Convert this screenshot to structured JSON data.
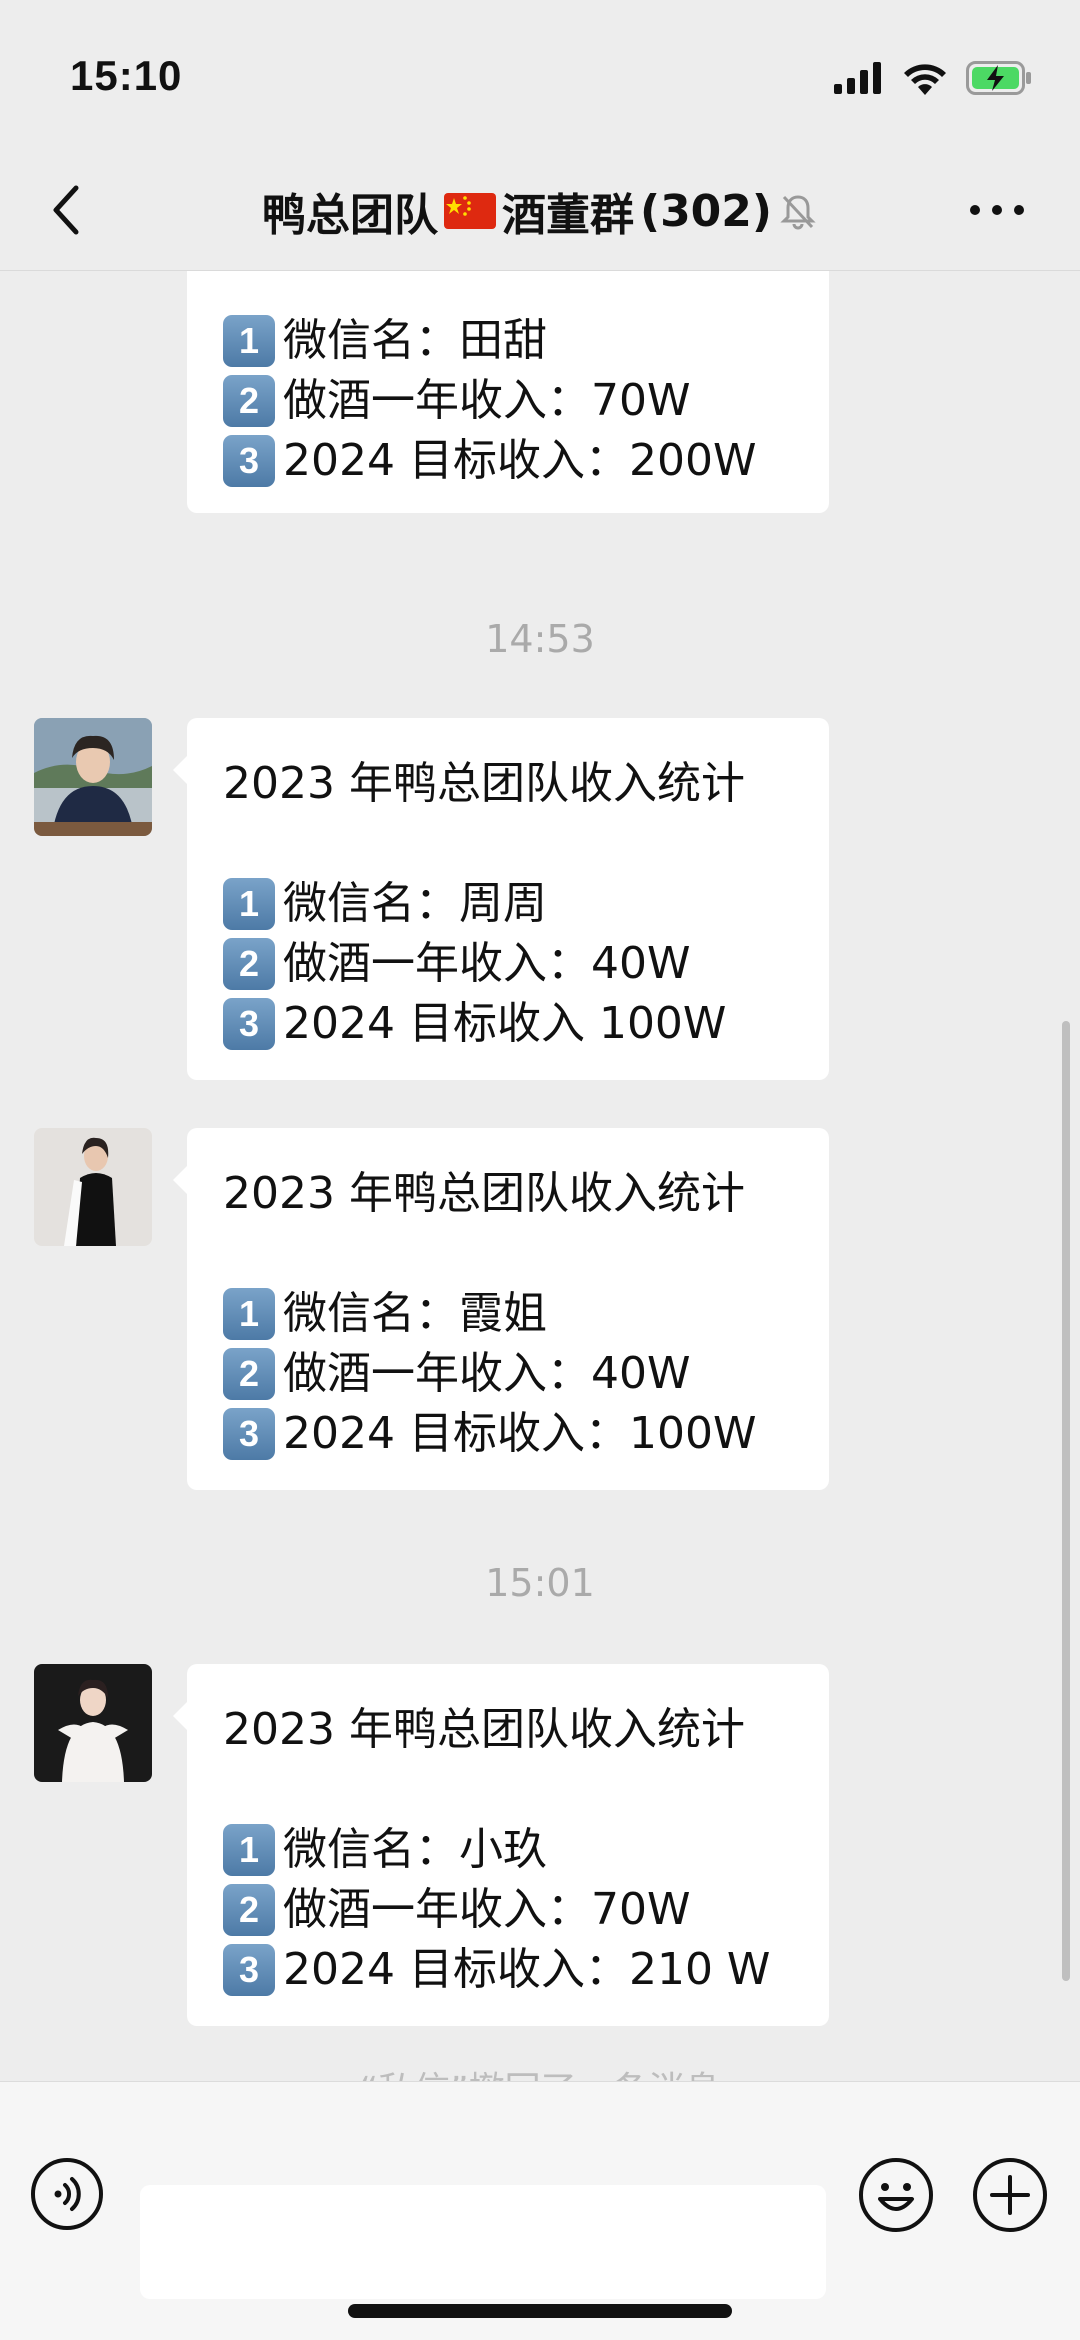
{
  "status_bar": {
    "time": "15:10"
  },
  "nav": {
    "title_part1": "鸭总团队",
    "title_part2": "酒董群",
    "member_count": "(302)"
  },
  "chat": {
    "partial_top": {
      "lines": [
        {
          "key": "1",
          "text": "微信名：田甜"
        },
        {
          "key": "2",
          "text": "做酒一年收入：70W"
        },
        {
          "key": "3",
          "text": "2024 目标收入：200W"
        }
      ]
    },
    "timestamp_1": "14:53",
    "msg_1": {
      "heading": "2023 年鸭总团队收入统计",
      "lines": [
        {
          "key": "1",
          "text": "微信名：周周"
        },
        {
          "key": "2",
          "text": "做酒一年收入：40W"
        },
        {
          "key": "3",
          "text": "2024 目标收入 100W"
        }
      ]
    },
    "msg_2": {
      "heading": "2023 年鸭总团队收入统计",
      "lines": [
        {
          "key": "1",
          "text": "微信名：霞姐"
        },
        {
          "key": "2",
          "text": "做酒一年收入：40W"
        },
        {
          "key": "3",
          "text": "2024 目标收入：100W"
        }
      ]
    },
    "timestamp_2": "15:01",
    "msg_3": {
      "heading": "2023 年鸭总团队收入统计",
      "lines": [
        {
          "key": "1",
          "text": "微信名：小玖"
        },
        {
          "key": "2",
          "text": "做酒一年收入：70W"
        },
        {
          "key": "3",
          "text": "2024 目标收入：210 W"
        }
      ]
    },
    "partial_bottom": "“私信”撤回了一条消息"
  },
  "input": {
    "value": "",
    "placeholder": ""
  },
  "icons": {
    "back": "chevron-left-icon",
    "mute": "bell-slash-icon",
    "more": "more-icon",
    "voice": "voice-icon",
    "emoji": "emoji-icon",
    "plus": "plus-icon",
    "signal": "signal-icon",
    "wifi": "wifi-icon",
    "battery": "battery-charging-icon"
  },
  "colors": {
    "background": "#ededed",
    "bubble": "#ffffff",
    "timestamp": "#aaaaaa",
    "keycap": "#5b86b0",
    "battery": "#4cd964"
  }
}
